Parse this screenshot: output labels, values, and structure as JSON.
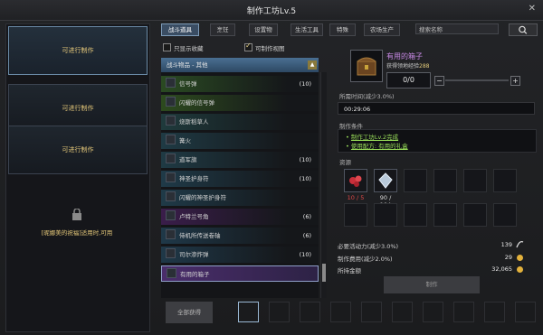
{
  "window": {
    "title": "制作工坊Lv.5",
    "close": "✕"
  },
  "queue": {
    "slots": [
      {
        "label": "可进行制作"
      },
      {
        "label": "可进行制作"
      },
      {
        "label": "可进行制作"
      }
    ],
    "locked_text": "[昵娜美的祝福]适用时,可用"
  },
  "tabs": [
    {
      "label": "战斗道具"
    },
    {
      "label": "烹饪"
    },
    {
      "label": "设置物"
    },
    {
      "label": "生活工具"
    },
    {
      "label": "特殊"
    },
    {
      "label": "农场生产"
    }
  ],
  "search": {
    "placeholder": "搜索名称"
  },
  "filters": {
    "owned_only": "只显示收藏",
    "craftable": "可制作视图"
  },
  "list": {
    "header": "战斗物品 - 其他",
    "items": [
      {
        "name": "信号弹",
        "count": "(10)",
        "color": "#2a4a22"
      },
      {
        "name": "闪耀的信号弹",
        "count": "",
        "color": "#2d4a1e"
      },
      {
        "name": "烧斯稻草人",
        "count": "",
        "color": "#1f3a3c"
      },
      {
        "name": "篝火",
        "count": "",
        "color": "#1f3a44"
      },
      {
        "name": "道军旗",
        "count": "(10)",
        "color": "#1f3a44"
      },
      {
        "name": "神圣护身符",
        "count": "(10)",
        "color": "#1f3a48"
      },
      {
        "name": "闪耀的神圣护身符",
        "count": "",
        "color": "#1f3a48"
      },
      {
        "name": "卢特兰号角",
        "count": "(6)",
        "color": "#3a1d4a"
      },
      {
        "name": "侍机所传送卷轴",
        "count": "(6)",
        "color": "#1f3848"
      },
      {
        "name": "司尔渗炸弹",
        "count": "(10)",
        "color": "#1f3848"
      },
      {
        "name": "有用的箱子",
        "count": "",
        "color": "#3a2356"
      }
    ],
    "get_all": "全部获得"
  },
  "detail": {
    "item_name": "有用的箱子",
    "xp_label": "获得领地经验",
    "xp_value": "288",
    "quantity": "0/0",
    "minus": "−",
    "plus": "+",
    "time_label": "所需时间(减少3.0%)",
    "time_value": "00:29:06",
    "cond_label": "制作条件",
    "conditions": [
      {
        "prefix": "• ",
        "text": "制作工坊Lv.2完成"
      },
      {
        "prefix": "• ",
        "text": "使用配方: 有用的礼盒"
      }
    ],
    "resource_label": "资源",
    "resources": [
      {
        "count": "10 / 5",
        "color": "#e04848"
      },
      {
        "count": "90 / 104",
        "color": "#d9d9d9"
      }
    ],
    "stats": [
      {
        "label": "必要活动力(减少3.0%)",
        "value": "139"
      },
      {
        "label": "制作费用(减少2.0%)",
        "value": "29"
      },
      {
        "label": "所持金额",
        "value": "32,065"
      }
    ],
    "craft": "制作"
  }
}
